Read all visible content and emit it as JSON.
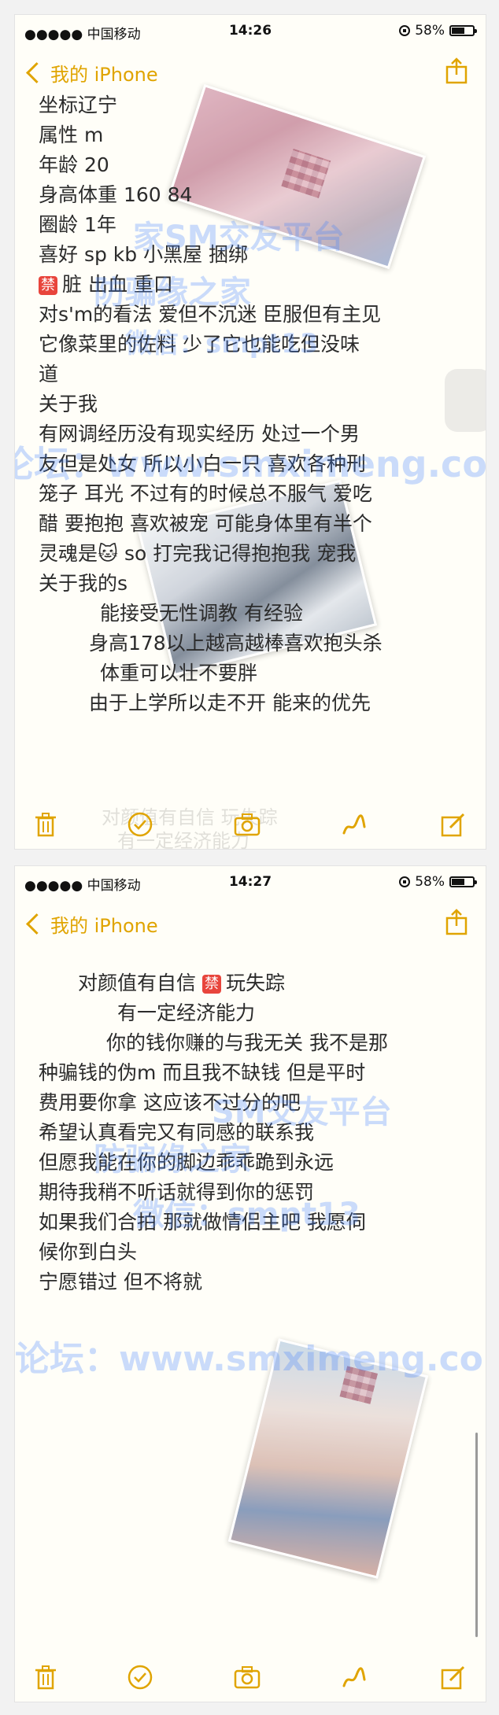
{
  "colors": {
    "accent": "#e0a400",
    "text": "#2b2b2b",
    "ban": "#e8453c",
    "watermark": "#4080ff"
  },
  "screens": [
    {
      "status": {
        "carrier": "●●●●● 中国移动",
        "time": "14:26",
        "battery": "58%",
        "battery_level": 0.58
      },
      "nav": {
        "back": "我的 iPhone"
      },
      "watermarks": [
        "家SM交友平台",
        "防骗缘之家",
        "微信：smpt13",
        "论坛：www.smximeng.com"
      ],
      "lines": [
        "坐标辽宁",
        "属性 m",
        "年龄 20",
        "身高体重 160 84",
        "圈龄 1年",
        "喜好 sp kb 小黑屋 捆绑",
        {
          "tag": "禁",
          "text": "脏 出血 重口"
        },
        "对s'm的看法 爱但不沉迷 臣服但有主见",
        "它像菜里的佐料 少了它也能吃但没味",
        "道",
        "关于我",
        "有网调经历没有现实经历 处过一个男",
        "友但是处女 所以小白一只 喜欢各种刑",
        "笼子 耳光 不过有的时候总不服气 爱吃",
        "醋 要抱抱 喜欢被宠 可能身体里有半个",
        "灵魂是🐱 so 打完我记得抱抱我 宠我",
        "关于我的s",
        "能接受无性调教 有经验",
        "身高178以上越高越棒喜欢抱头杀",
        "体重可以壮不要胖",
        "由于上学所以走不开 能来的优先"
      ],
      "faded": [
        "对颜值有自信 玩失踪",
        "有一定经济能力"
      ]
    },
    {
      "status": {
        "carrier": "●●●●● 中国移动",
        "time": "14:27",
        "battery": "58%",
        "battery_level": 0.58
      },
      "nav": {
        "back": "我的 iPhone"
      },
      "watermarks": [
        "SM交友平台",
        "防骗缘之家",
        "微信：smpt13",
        "论坛：www.smximeng.com"
      ],
      "lines": [
        {
          "tag": "禁",
          "pre": "对颜值有自信 ",
          "text": "玩失踪"
        },
        "有一定经济能力",
        "你的钱你赚的与我无关 我不是那",
        "种骗钱的伪m 而且我不缺钱 但是平时",
        "费用要你拿 这应该不过分的吧",
        "希望认真看完又有同感的联系我",
        "但愿我能在你的脚边乖乖跪到永远",
        "期待我稍不听话就得到你的惩罚",
        "如果我们合拍 那就做情侣主吧 我愿伺",
        "候你到白头",
        "宁愿错过 但不将就"
      ]
    }
  ],
  "icons": {
    "share": "share-icon",
    "trash": "trash-icon",
    "check": "checklist-icon",
    "camera": "camera-icon",
    "sketch": "sketch-icon",
    "compose": "compose-icon"
  }
}
